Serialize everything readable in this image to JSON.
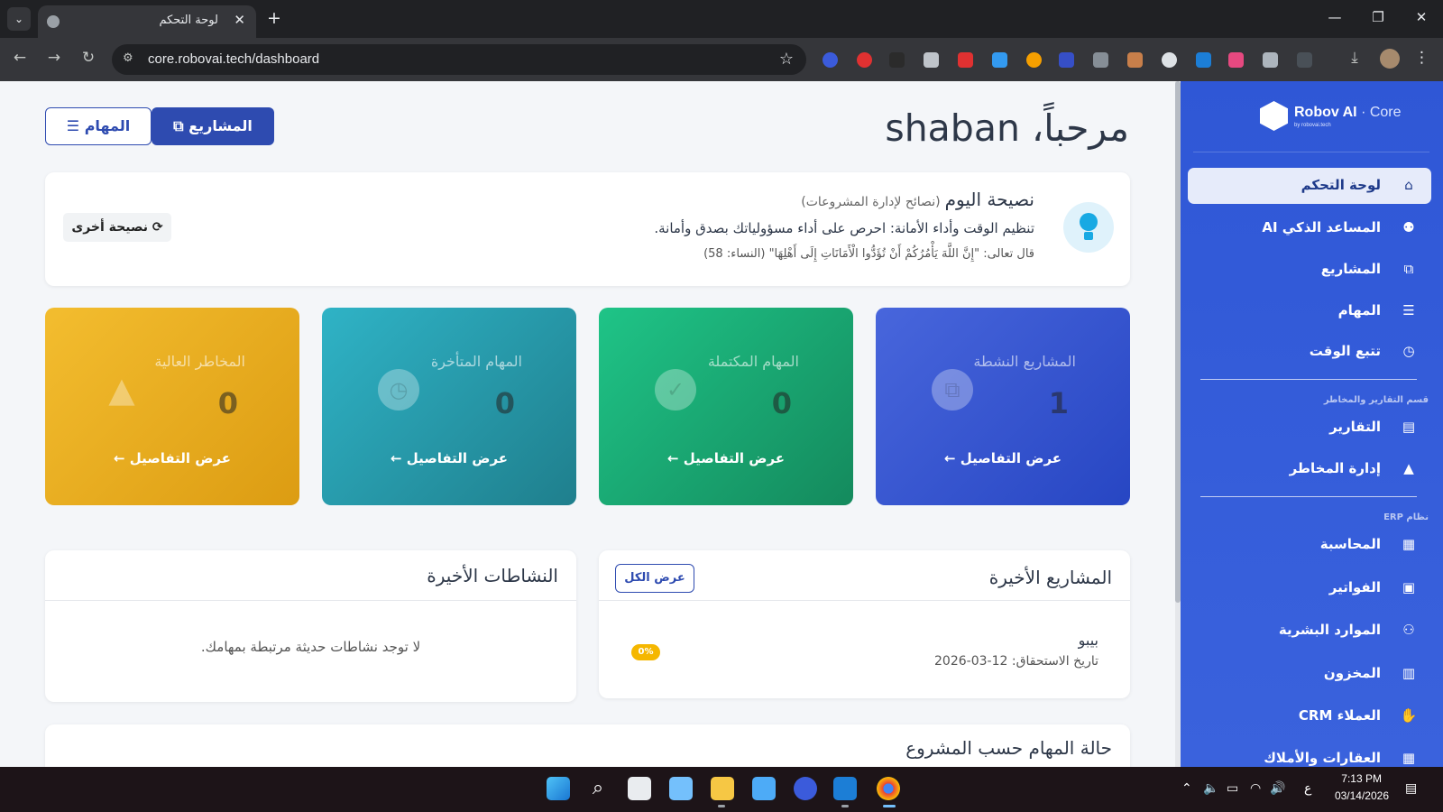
{
  "browser": {
    "tab_title": "لوحة التحكم",
    "tab_close": "✕",
    "new_tab": "+",
    "url": "core.robovai.tech/dashboard",
    "win_minimize": "—",
    "win_restore": "❐",
    "win_close": "✕"
  },
  "header": {
    "greeting": "مرحباً، shaban",
    "projects_button": "المشاريع",
    "tasks_button": "المهام"
  },
  "tip": {
    "title": "نصيحة اليوم",
    "subtitle": "(نصائح لإدارة المشروعات)",
    "text": "تنظيم الوقت وأداء الأمانة: احرص على أداء مسؤولياتك بصدق وأمانة.",
    "quote": "قال تعالى: \"إِنَّ اللَّهَ يَأْمُرُكُمْ أَنْ تُؤَدُّوا الْأَمَانَاتِ إِلَى أَهْلِهَا\" (النساء: 58)",
    "another_button": "نصيحة أخرى"
  },
  "stats": [
    {
      "label": "المشاريع النشطة",
      "value": "1",
      "link": "عرض التفاصيل",
      "icon": "project-diagram-icon",
      "color": "#3557d4"
    },
    {
      "label": "المهام المكتملة",
      "value": "0",
      "link": "عرض التفاصيل",
      "icon": "check-circle-icon",
      "color": "#1aa56e"
    },
    {
      "label": "المهام المتأخرة",
      "value": "0",
      "link": "عرض التفاصيل",
      "icon": "clock-icon",
      "color": "#2595a8"
    },
    {
      "label": "المخاطر العالية",
      "value": "0",
      "link": "عرض التفاصيل",
      "icon": "warning-icon",
      "color": "#e6a91d"
    }
  ],
  "recent_projects": {
    "title": "المشاريع الأخيرة",
    "view_all": "عرض الكل",
    "items": [
      {
        "name": "بيبو",
        "due": "تاريخ الاستحقاق: 12-03-2026",
        "progress": "0%"
      }
    ]
  },
  "recent_activities": {
    "title": "النشاطات الأخيرة",
    "empty": "لا توجد نشاطات حديثة مرتبطة بمهامك."
  },
  "task_status": {
    "title": "حالة المهام حسب المشروع"
  },
  "sidebar": {
    "brand": "Robov AI",
    "brand_sep": " · ",
    "brand_core": "Core",
    "brand_sub": "by robovai.tech",
    "items": [
      {
        "label": "لوحة التحكم",
        "icon": "home-icon",
        "active": true
      },
      {
        "label": "المساعد الذكي AI",
        "icon": "robot-icon"
      },
      {
        "label": "المشاريع",
        "icon": "project-diagram-icon"
      },
      {
        "label": "المهام",
        "icon": "tasks-icon"
      },
      {
        "label": "تتبع الوقت",
        "icon": "clock-icon"
      }
    ],
    "section_reports": "قسم التقارير والمخاطر",
    "reports_items": [
      {
        "label": "التقارير",
        "icon": "chart-icon"
      },
      {
        "label": "إدارة المخاطر",
        "icon": "warning-icon"
      }
    ],
    "section_erp": "نظام ERP",
    "erp_items": [
      {
        "label": "المحاسبة",
        "icon": "calculator-icon"
      },
      {
        "label": "الفواتير",
        "icon": "invoice-icon"
      },
      {
        "label": "الموارد البشرية",
        "icon": "users-icon"
      },
      {
        "label": "المخزون",
        "icon": "boxes-icon"
      },
      {
        "label": "العملاء CRM",
        "icon": "handshake-icon"
      },
      {
        "label": "العقارات والأملاك",
        "icon": "building-icon"
      }
    ]
  },
  "taskbar": {
    "time": "7:13 PM",
    "date": "03/14/2026",
    "lang": "ع"
  }
}
